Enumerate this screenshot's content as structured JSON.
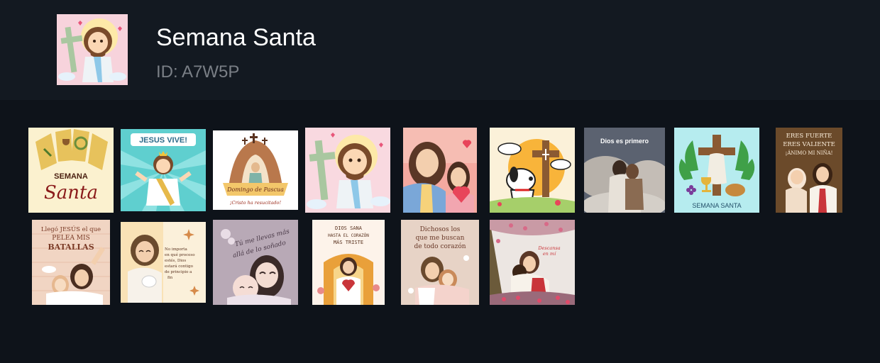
{
  "pack": {
    "title": "Semana Santa",
    "id_text": "ID: A7W5P"
  },
  "stickers": [
    {
      "name": "sticker-semana-santa-chalice",
      "text1": "SEMANA",
      "text2": "Santa"
    },
    {
      "name": "sticker-jesus-vive",
      "text1": "JESUS VIVE!"
    },
    {
      "name": "sticker-domingo-de-pascua",
      "text1": "Domingo de Pascua",
      "text2": "¡Cristo ha resucitado!"
    },
    {
      "name": "sticker-jesus-cross-cute"
    },
    {
      "name": "sticker-jesus-girl-heart"
    },
    {
      "name": "sticker-snoopy-cross"
    },
    {
      "name": "sticker-dios-es-primero",
      "text1": "Dios es primero"
    },
    {
      "name": "sticker-semana-santa-cross-chalice",
      "text1": "SEMANA SANTA"
    },
    {
      "name": "sticker-eres-fuerte",
      "text1": "ERES FUERTE",
      "text2": "ERES VALIENTE",
      "text3": "¡ÁNIMO MI NIÑA!"
    },
    {
      "name": "sticker-llego-jesus",
      "text1": "Llegó JESÚS el que",
      "text2": "PELEA MIS",
      "text3": "BATALLAS"
    },
    {
      "name": "sticker-no-importa",
      "text1": "No importa",
      "text2": "en qué proceso",
      "text3": "estés, Dios",
      "text4": "estará contigo",
      "text5": "de principio a",
      "text6": "fin"
    },
    {
      "name": "sticker-tu-me-llevas",
      "text1": "Tú me llevas más",
      "text2": "allá de lo soñado"
    },
    {
      "name": "sticker-dios-sana",
      "text1": "DIOS SANA",
      "text2": "HASTA EL CORAZÓN",
      "text3": "MÁS TRISTE"
    },
    {
      "name": "sticker-dichosos",
      "text1": "Dichosos los",
      "text2": "que me buscan",
      "text3": "de todo corazón"
    },
    {
      "name": "sticker-descansa-en-mi",
      "text1": "Descansa",
      "text2": "en mí"
    }
  ]
}
